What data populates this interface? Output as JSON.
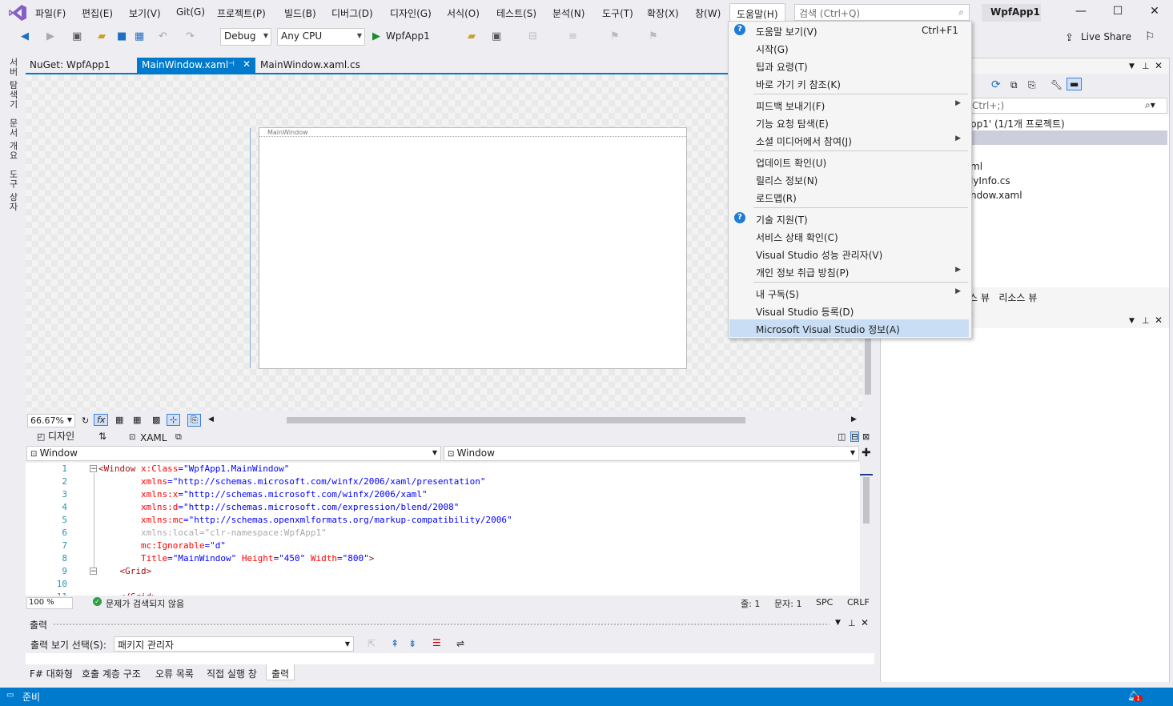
{
  "menubar": {
    "items": [
      "파일(F)",
      "편집(E)",
      "보기(V)",
      "Git(G)",
      "프로젝트(P)",
      "빌드(B)",
      "디버그(D)",
      "디자인(G)",
      "서식(O)",
      "테스트(S)",
      "분석(N)",
      "도구(T)",
      "확장(X)",
      "창(W)",
      "도움말(H)"
    ],
    "search_placeholder": "검색 (Ctrl+Q)",
    "solution_name": "WpfApp1"
  },
  "toolbar": {
    "config": "Debug",
    "platform": "Any CPU",
    "start_label": "WpfApp1",
    "live_share": "Live Share"
  },
  "side_tabs": [
    "서버 탐색기",
    "문서 개요",
    "도구 상자"
  ],
  "doc_tabs": [
    "NuGet: WpfApp1",
    "MainWindow.xaml",
    "MainWindow.xaml.cs"
  ],
  "designer": {
    "window_title": "MainWindow",
    "zoom": "66.67%",
    "design_tab": "디자인",
    "xaml_tab": "XAML"
  },
  "combos": {
    "left": "Window",
    "right": "Window"
  },
  "code_lines": [
    {
      "n": "1",
      "parts": [
        [
          "el",
          "<Window "
        ],
        [
          "at",
          "x:Class"
        ],
        [
          "va",
          "=\"WpfApp1.MainWindow\""
        ]
      ]
    },
    {
      "n": "2",
      "parts": [
        [
          "at",
          "        xmlns"
        ],
        [
          "va",
          "=\"http://schemas.microsoft.com/winfx/2006/xaml/presentation\""
        ]
      ]
    },
    {
      "n": "3",
      "parts": [
        [
          "at",
          "        xmlns:x"
        ],
        [
          "va",
          "=\"http://schemas.microsoft.com/winfx/2006/xaml\""
        ]
      ]
    },
    {
      "n": "4",
      "parts": [
        [
          "at",
          "        xmlns:d"
        ],
        [
          "va",
          "=\"http://schemas.microsoft.com/expression/blend/2008\""
        ]
      ]
    },
    {
      "n": "5",
      "parts": [
        [
          "at",
          "        xmlns:mc"
        ],
        [
          "va",
          "=\"http://schemas.openxmlformats.org/markup-compatibility/2006\""
        ]
      ]
    },
    {
      "n": "6",
      "parts": [
        [
          "dim",
          "        xmlns:local=\"clr-namespace:WpfApp1\""
        ]
      ]
    },
    {
      "n": "7",
      "parts": [
        [
          "at",
          "        mc:Ignorable"
        ],
        [
          "va",
          "=\"d\""
        ]
      ]
    },
    {
      "n": "8",
      "parts": [
        [
          "at",
          "        Title"
        ],
        [
          "va",
          "=\"MainWindow\" "
        ],
        [
          "at",
          "Height"
        ],
        [
          "va",
          "=\"450\" "
        ],
        [
          "at",
          "Width"
        ],
        [
          "va",
          "=\"800\""
        ],
        [
          "el",
          ">"
        ]
      ]
    },
    {
      "n": "9",
      "parts": [
        [
          "el",
          "    <Grid>"
        ]
      ]
    },
    {
      "n": "10",
      "parts": [
        [
          "el",
          ""
        ]
      ]
    },
    {
      "n": "11",
      "parts": [
        [
          "el",
          "    </Grid>"
        ]
      ]
    }
  ],
  "editor_status": {
    "zoom": "100 %",
    "issues": "문제가 검색되지 않음",
    "line": "줄: 1",
    "col": "문자: 1",
    "spc": "SPC",
    "crlf": "CRLF"
  },
  "output": {
    "title": "출력",
    "source_label": "출력 보기 선택(S):",
    "source_value": "패키지 관리자"
  },
  "bottom_tabs": [
    "F# 대화형",
    "호출 계층 구조",
    "오류 목록",
    "직접 실행 창",
    "출력"
  ],
  "status": {
    "ready": "준비",
    "notif_count": "1"
  },
  "solution_explorer": {
    "search_hint": "Ctrl+;)",
    "root": "pp1' (1/1개 프로젝트)",
    "items": [
      "ml",
      "lyInfo.cs",
      "ndow.xaml"
    ],
    "tabs": "스 뷰   리소스 뷰"
  },
  "help_menu": {
    "items": [
      {
        "label": "도움말 보기(V)",
        "shortcut": "Ctrl+F1",
        "icon": true
      },
      {
        "label": "시작(G)"
      },
      {
        "label": "팁과 요령(T)"
      },
      {
        "label": "바로 가기 키 참조(K)"
      },
      {
        "label": "피드백 보내기(F)",
        "sub": true
      },
      {
        "label": "기능 요청 탐색(E)"
      },
      {
        "label": "소셜 미디어에서 참여(J)",
        "sub": true
      },
      {
        "label": "업데이트 확인(U)"
      },
      {
        "label": "릴리스 정보(N)"
      },
      {
        "label": "로드맵(R)"
      },
      {
        "label": "기술 지원(T)",
        "icon": true
      },
      {
        "label": "서비스 상태 확인(C)"
      },
      {
        "label": "Visual Studio 성능 관리자(V)"
      },
      {
        "label": "개인 정보 취급 방침(P)",
        "sub": true
      },
      {
        "label": "내 구독(S)",
        "sub": true
      },
      {
        "label": "Visual Studio 등록(D)"
      },
      {
        "label": "Microsoft Visual Studio 정보(A)",
        "highlight": true
      }
    ]
  },
  "colors": {
    "accent": "#007acc",
    "highlight": "#c9def5",
    "vs_purple": "#68217a"
  }
}
